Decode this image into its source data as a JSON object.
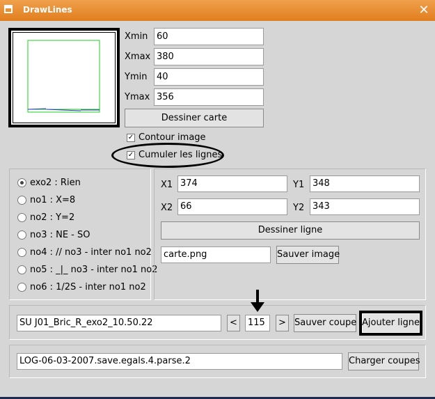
{
  "window": {
    "title": "DrawLines",
    "close_glyph": "✕"
  },
  "map_bounds": [
    {
      "label": "Xmin",
      "value": "60"
    },
    {
      "label": "Xmax",
      "value": "380"
    },
    {
      "label": "Ymin",
      "value": "40"
    },
    {
      "label": "Ymax",
      "value": "356"
    }
  ],
  "draw_map_button": "Dessiner carte",
  "checkboxes": [
    {
      "label": "Contour image",
      "checked": true
    },
    {
      "label": "Cumuler les lignes",
      "checked": true
    }
  ],
  "check_glyph": "✓",
  "exercises": [
    {
      "label": "exo2 : Rien",
      "selected": true
    },
    {
      "label": "no1 : X=8",
      "selected": false
    },
    {
      "label": "no2 : Y=2",
      "selected": false
    },
    {
      "label": "no3 : NE - SO",
      "selected": false
    },
    {
      "label": "no4 : // no3 - inter no1 no2",
      "selected": false
    },
    {
      "label": "no5 : _|_ no3 - inter no1 no2",
      "selected": false
    },
    {
      "label": "no6 : 1/2S - inter no1 no2",
      "selected": false
    }
  ],
  "line_coords": {
    "x1_label": "X1",
    "x1": "374",
    "y1_label": "Y1",
    "y1": "348",
    "x2_label": "X2",
    "x2": "66",
    "y2_label": "Y2",
    "y2": "343"
  },
  "draw_line_button": "Dessiner ligne",
  "image_file": "carte.png",
  "save_image_button": "Sauver image",
  "cut": {
    "name": "SU J01_Bric_R_exo2_10.50.22",
    "prev": "<",
    "index": "115",
    "next": ">",
    "save_cut_button": "Sauver coupe",
    "add_line_button": "Ajouter ligne"
  },
  "log": {
    "file": "LOG-06-03-2007.save.egals.4.parse.2",
    "load_cuts_button": "Charger coupes"
  },
  "colors": {
    "title_bar": "#e88a2c",
    "preview_line_green": "#22cc22",
    "preview_line_blue": "#3333cc"
  }
}
